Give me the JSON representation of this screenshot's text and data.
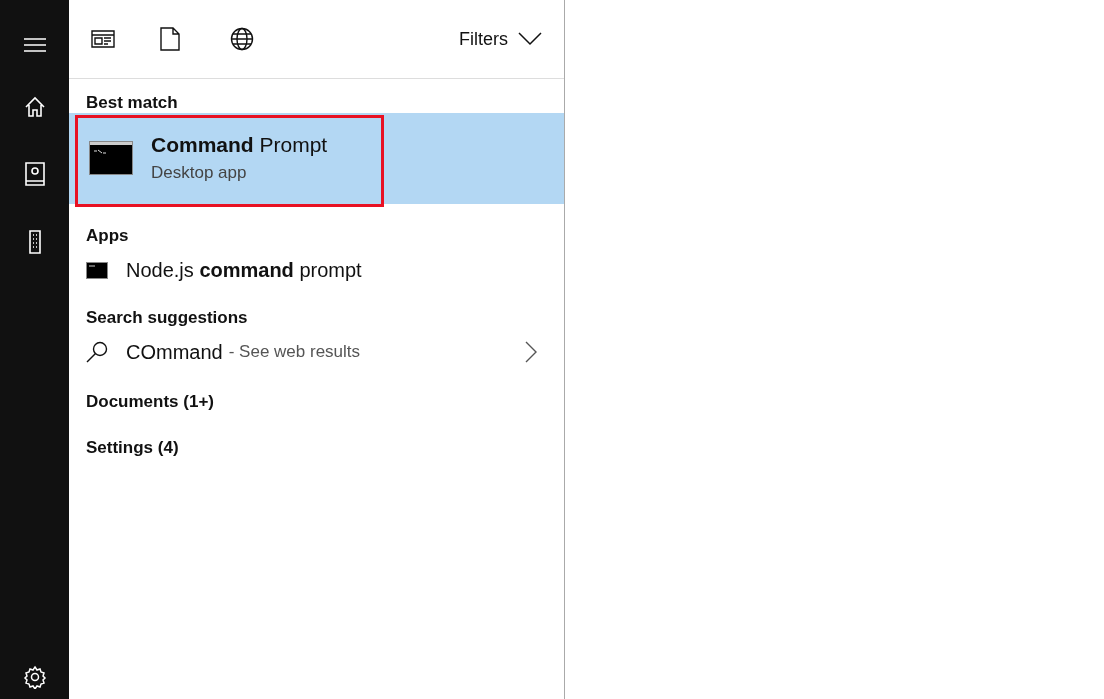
{
  "header": {
    "filters": {
      "label": "Filters"
    }
  },
  "best_match": {
    "heading": "Best match",
    "title": "**Command** Prompt",
    "subtitle": "Desktop app",
    "selected": true,
    "outlined": true
  },
  "apps": {
    "heading": "Apps",
    "items": [
      {
        "label": "Node.js **command** prompt"
      }
    ]
  },
  "suggestions": {
    "heading": "Search suggestions",
    "items": [
      {
        "query": "COmmand",
        "hint": "- See web results"
      }
    ]
  },
  "more": [
    {
      "label": "Documents (1+)"
    },
    {
      "label": "Settings (4)"
    }
  ]
}
